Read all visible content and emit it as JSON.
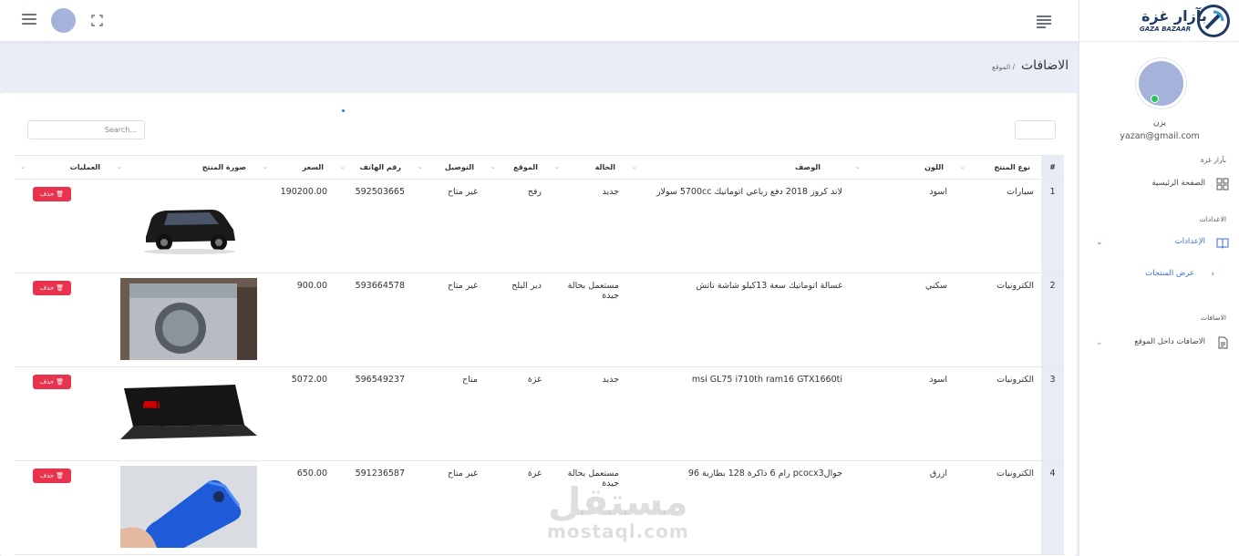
{
  "sidebar": {
    "brand_ar": "بآزار غزة",
    "brand_en": "GAZA BAZAAR",
    "user_name": "يزن",
    "user_email": "yazan@gmail.com",
    "section_main": "بآزار غزة",
    "item_home": "الصفحة الرئيسية",
    "section_settings": "الاعدادات",
    "item_settings": "الإعدادات",
    "item_view_products": "عرض المنتجات",
    "section_additions": "الاضافات",
    "item_site_additions": "الاضافات داخل الموقع"
  },
  "page": {
    "title": "الاضافات",
    "breadcrumb": "/ الموقع"
  },
  "table": {
    "search_placeholder": "Search...",
    "headers": {
      "num": "#",
      "type": "نوع المنتج",
      "desc": "الوصف",
      "color": "اللون",
      "condition": "الحالة",
      "location": "الموقع",
      "delivery": "التوصيل",
      "phone": "رقم الهاتف",
      "price": "السعر",
      "image": "صورة المنتج",
      "ops": "العمليات"
    },
    "delete_label": "🗑 حذف",
    "rows": [
      {
        "num": "1",
        "type": "سيارات",
        "desc": "لاند كروز 2018 دفع رباعي اتوماتيك 5700cc سولار",
        "color": "اسود",
        "condition": "جديد",
        "location": "رفح",
        "delivery": "غير متاح",
        "phone": "592503665",
        "price": "190200.00",
        "image": "car"
      },
      {
        "num": "2",
        "type": "الكترونيات",
        "desc": "غسالة اتوماتيك سعة 13كيلو شاشة تاتش",
        "color": "سكني",
        "condition": "مستعمل بحالة جيدة",
        "location": "دير البلح",
        "delivery": "غير متاح",
        "phone": "593664578",
        "price": "900.00",
        "image": "washer"
      },
      {
        "num": "3",
        "type": "الكترونيات",
        "desc": "msi GL75 i710th ram16 GTX1660ti",
        "color": "اسود",
        "condition": "جديد",
        "location": "غزة",
        "delivery": "متاح",
        "phone": "596549237",
        "price": "5072.00",
        "image": "laptop"
      },
      {
        "num": "4",
        "type": "الكترونيات",
        "desc": "جوالpcocx3 رام 6 ذاكرة 128 بطارية 96",
        "color": "ازرق",
        "condition": "مستعمل بحالة جيدة",
        "location": "غزة",
        "delivery": "غير متاح",
        "phone": "591236587",
        "price": "650.00",
        "image": "phone"
      }
    ]
  },
  "watermark": {
    "ar": "مستقل",
    "en": "mostaql.com"
  }
}
